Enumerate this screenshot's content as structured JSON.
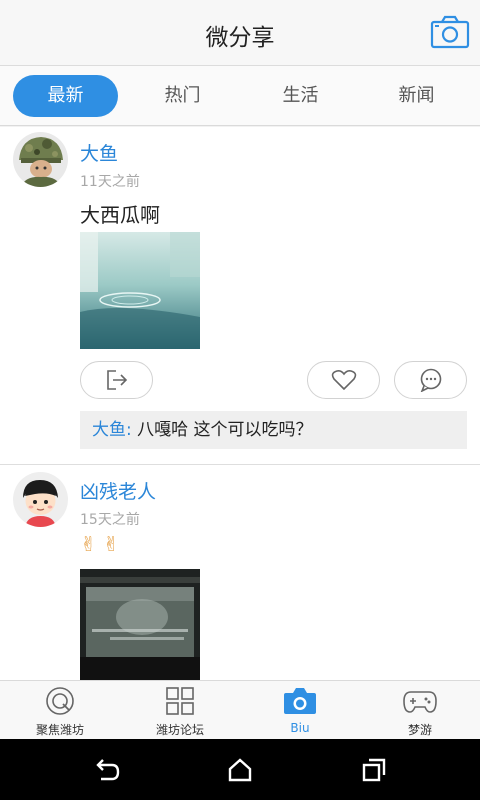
{
  "header": {
    "title": "微分享",
    "camera_icon": "camera-icon"
  },
  "tabs": [
    {
      "label": "最新",
      "active": true
    },
    {
      "label": "热门",
      "active": false
    },
    {
      "label": "生活",
      "active": false
    },
    {
      "label": "新闻",
      "active": false
    }
  ],
  "posts": [
    {
      "username": "大鱼",
      "time": "11天之前",
      "content": "大西瓜啊",
      "comment": {
        "user": "大鱼:",
        "text": " 八嘎哈 这个可以吃吗？"
      }
    },
    {
      "username": "凶残老人",
      "time": "15天之前",
      "content": "✌✌"
    }
  ],
  "bottom_nav": [
    {
      "label": "聚焦潍坊",
      "icon": "focus-icon"
    },
    {
      "label": "潍坊论坛",
      "icon": "grid-icon"
    },
    {
      "label": "Biu",
      "icon": "camera-icon",
      "active": true
    },
    {
      "label": "梦游",
      "icon": "gamepad-icon"
    }
  ],
  "colors": {
    "accent": "#2f8fe3",
    "username": "#2b86d8"
  }
}
